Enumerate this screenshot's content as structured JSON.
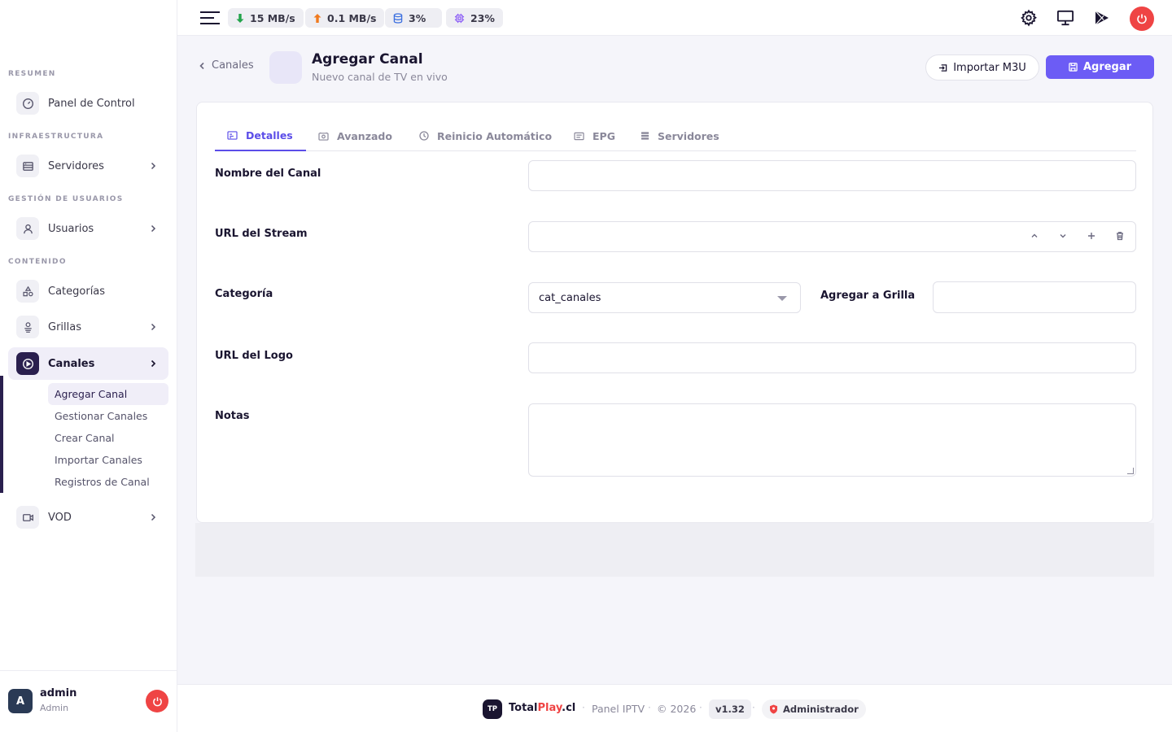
{
  "colors": {
    "accent": "#6c5cf5",
    "sidebar_active": "#2a1f4e",
    "danger": "#ef4444",
    "brand_red": "#ef4444"
  },
  "sidebar": {
    "sections": [
      "RESUMEN",
      "INFRAESTRUCTURA",
      "GESTIÓN DE USUARIOS",
      "CONTENIDO"
    ],
    "items": [
      {
        "label": "Panel de Control",
        "icon": "dashboard-icon"
      },
      {
        "label": "Servidores",
        "icon": "server-icon"
      },
      {
        "label": "Usuarios",
        "icon": "user-icon"
      },
      {
        "label": "Categorías",
        "icon": "shapes-icon"
      },
      {
        "label": "Grillas",
        "icon": "grid-icon"
      },
      {
        "label": "Canales",
        "icon": "play-icon"
      },
      {
        "label": "VOD",
        "icon": "video-icon"
      }
    ],
    "subitems": [
      "Agregar Canal",
      "Gestionar Canales",
      "Crear Canal",
      "Importar Canales",
      "Registros de Canal"
    ],
    "user": {
      "initial": "A",
      "name": "admin",
      "role": "Admin"
    }
  },
  "topbar": {
    "download": "15 MB/s",
    "upload": "0.1 MB/s",
    "disk": "3%",
    "cpu": "23%"
  },
  "header": {
    "back": "Canales",
    "title": "Agregar Canal",
    "subtitle": "Nuevo canal de TV en vivo",
    "import_label": "Importar M3U",
    "add_label": "Agregar"
  },
  "tabs": [
    "Detalles",
    "Avanzado",
    "Reinicio Automático",
    "EPG",
    "Servidores"
  ],
  "form": {
    "name_label": "Nombre del Canal",
    "stream_label": "URL del Stream",
    "category_label": "Categoría",
    "category_value": "cat_canales",
    "grilla_label": "Agregar a Grilla",
    "logo_label": "URL del Logo",
    "notes_label": "Notas"
  },
  "footer": {
    "logo": "TP",
    "brand_a": "Total",
    "brand_b": "Play",
    "brand_c": ".cl",
    "product": "Panel IPTV",
    "copyright": "© 2026",
    "version": "v1.32",
    "role": "Administrador"
  }
}
